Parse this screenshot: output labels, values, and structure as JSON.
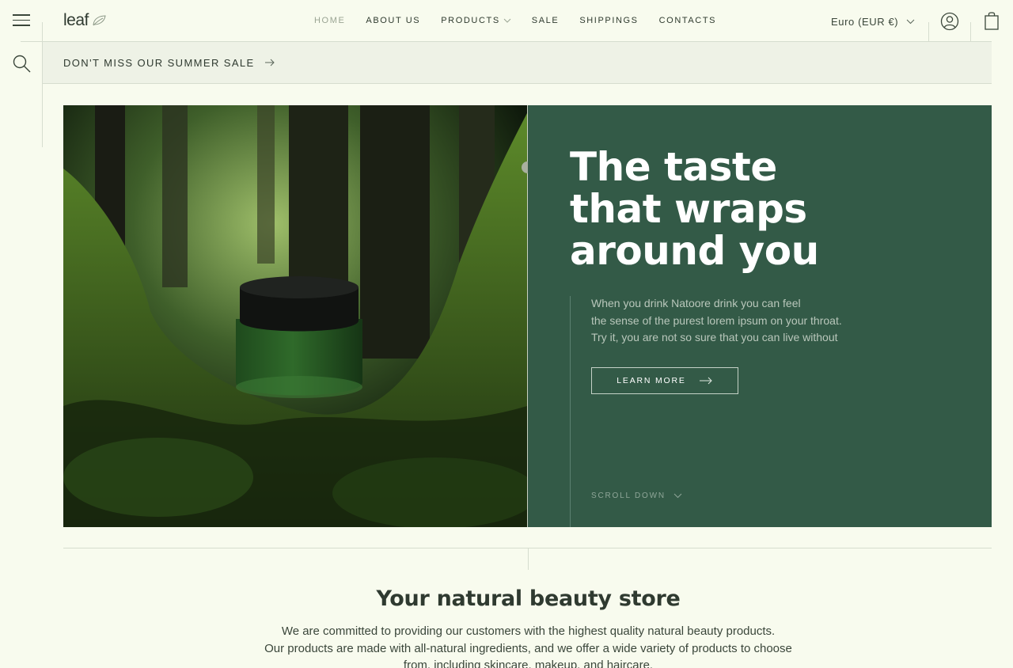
{
  "header": {
    "logo_text": "leaf",
    "nav": [
      {
        "label": "HOME",
        "active": true
      },
      {
        "label": "ABOUT US"
      },
      {
        "label": "PRODUCTS"
      },
      {
        "label": "SALE"
      },
      {
        "label": "SHIPPINGS"
      },
      {
        "label": "CONTACTS"
      }
    ],
    "currency": "Euro (EUR €)"
  },
  "promo": {
    "text": "DON'T MISS OUR SUMMER SALE"
  },
  "hero": {
    "title_lines": [
      "The taste",
      "that wraps",
      "around you"
    ],
    "description_lines": [
      "When you drink Natoore drink you can feel",
      "the sense of the purest lorem ipsum on your throat.",
      "Try it, you are not so sure that you can  live without"
    ],
    "button_label": "LEARN MORE",
    "scroll_label": "SCROLL DOWN"
  },
  "section": {
    "title": "Your natural beauty store",
    "text_lines": [
      "We are committed to providing our customers with the highest quality natural beauty products.",
      "Our products are made with all-natural ingredients, and we offer a wide variety of products to choose",
      "from, including skincare, makeup, and haircare."
    ]
  },
  "colors": {
    "background": "#f8fbee",
    "hero_panel": "#335a47",
    "promo_bg": "#eef2e6"
  }
}
